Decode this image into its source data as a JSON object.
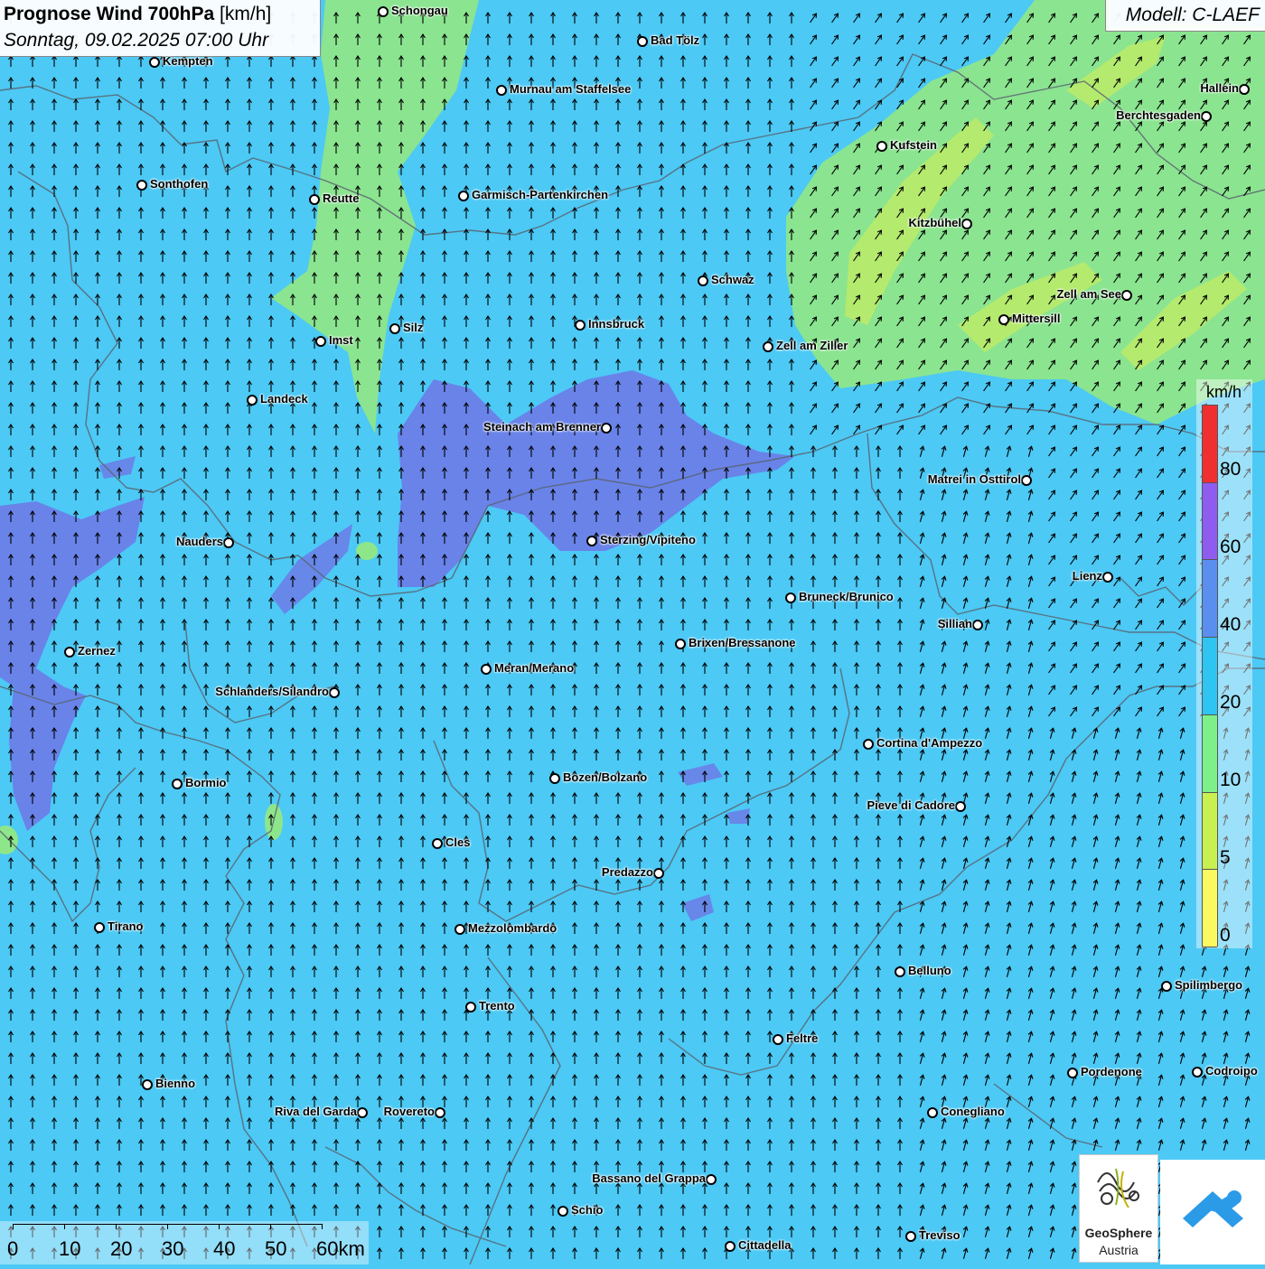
{
  "title": {
    "main": "Prognose Wind 700hPa",
    "unit": "[km/h]",
    "datetime": "Sonntag, 09.02.2025 07:00 Uhr"
  },
  "model": "Modell: C-LAEF",
  "legend": {
    "unit": "km/h",
    "labels": [
      "80",
      "60",
      "40",
      "20",
      "10",
      "5",
      "0"
    ],
    "colors": [
      "#f03030",
      "#8f5cf0",
      "#5a8ff0",
      "#2ec5f2",
      "#7ef08a",
      "#c8f050",
      "#fafa60"
    ]
  },
  "scalebar": {
    "labels": [
      "0",
      "10",
      "20",
      "30",
      "40",
      "50",
      "60km"
    ]
  },
  "logo": {
    "name": "GeoSphere",
    "sub": "Austria"
  },
  "colors": {
    "wind_20_40": "#4cc9f5",
    "wind_10_20": "#8ee68a",
    "wind_5_10": "#b8ea6a",
    "wind_40_60": "#6a7fe8",
    "border": "#5a6470",
    "arrow": "#000000"
  },
  "cities": [
    {
      "name": "Schongau",
      "side": "right"
    },
    {
      "name": "Bad Tölz",
      "side": "right"
    },
    {
      "name": "Kempten",
      "side": "right"
    },
    {
      "name": "Murnau am Staffelsee",
      "side": "right"
    },
    {
      "name": "Hallein",
      "side": "left"
    },
    {
      "name": "Berchtesgaden",
      "side": "left"
    },
    {
      "name": "Kufstein",
      "side": "right"
    },
    {
      "name": "Sonthofen",
      "side": "right"
    },
    {
      "name": "Reutte",
      "side": "right"
    },
    {
      "name": "Garmisch-Partenkirchen",
      "side": "right"
    },
    {
      "name": "Kitzbühel",
      "side": "left"
    },
    {
      "name": "Schwaz",
      "side": "right"
    },
    {
      "name": "Zell am See",
      "side": "left"
    },
    {
      "name": "Mittersill",
      "side": "right"
    },
    {
      "name": "Silz",
      "side": "right"
    },
    {
      "name": "Innsbruck",
      "side": "right"
    },
    {
      "name": "Imst",
      "side": "right"
    },
    {
      "name": "Zell am Ziller",
      "side": "right"
    },
    {
      "name": "Landeck",
      "side": "right"
    },
    {
      "name": "Steinach am Brenner",
      "side": "left"
    },
    {
      "name": "Matrei in Osttirol",
      "side": "left"
    },
    {
      "name": "Nauders",
      "side": "left"
    },
    {
      "name": "Sterzing/Vipiteno",
      "side": "right"
    },
    {
      "name": "Lienz",
      "side": "left"
    },
    {
      "name": "Bruneck/Brunico",
      "side": "right"
    },
    {
      "name": "Sillian",
      "side": "left"
    },
    {
      "name": "Zernez",
      "side": "right"
    },
    {
      "name": "Brixen/Bressanone",
      "side": "right"
    },
    {
      "name": "Meran/Merano",
      "side": "right"
    },
    {
      "name": "Schlanders/Silandro",
      "side": "left"
    },
    {
      "name": "Cortina d'Ampezzo",
      "side": "right"
    },
    {
      "name": "Bozen/Bolzano",
      "side": "right"
    },
    {
      "name": "Bormio",
      "side": "right"
    },
    {
      "name": "Pieve di Cadore",
      "side": "left"
    },
    {
      "name": "Cles",
      "side": "right"
    },
    {
      "name": "Predazzo",
      "side": "left"
    },
    {
      "name": "Tirano",
      "side": "right"
    },
    {
      "name": "Mezzolombardo",
      "side": "right"
    },
    {
      "name": "Belluno",
      "side": "right"
    },
    {
      "name": "Spilimbergo",
      "side": "right"
    },
    {
      "name": "Trento",
      "side": "right"
    },
    {
      "name": "Feltre",
      "side": "right"
    },
    {
      "name": "Pordenone",
      "side": "right"
    },
    {
      "name": "Codroipo",
      "side": "right"
    },
    {
      "name": "Bienno",
      "side": "right"
    },
    {
      "name": "Riva del Garda",
      "side": "left"
    },
    {
      "name": "Rovereto",
      "side": "left"
    },
    {
      "name": "Conegliano",
      "side": "right"
    },
    {
      "name": "Bassano del Grappa",
      "side": "left"
    },
    {
      "name": "Schio",
      "side": "right"
    },
    {
      "name": "Treviso",
      "side": "right"
    },
    {
      "name": "Cittadella",
      "side": "right"
    }
  ]
}
